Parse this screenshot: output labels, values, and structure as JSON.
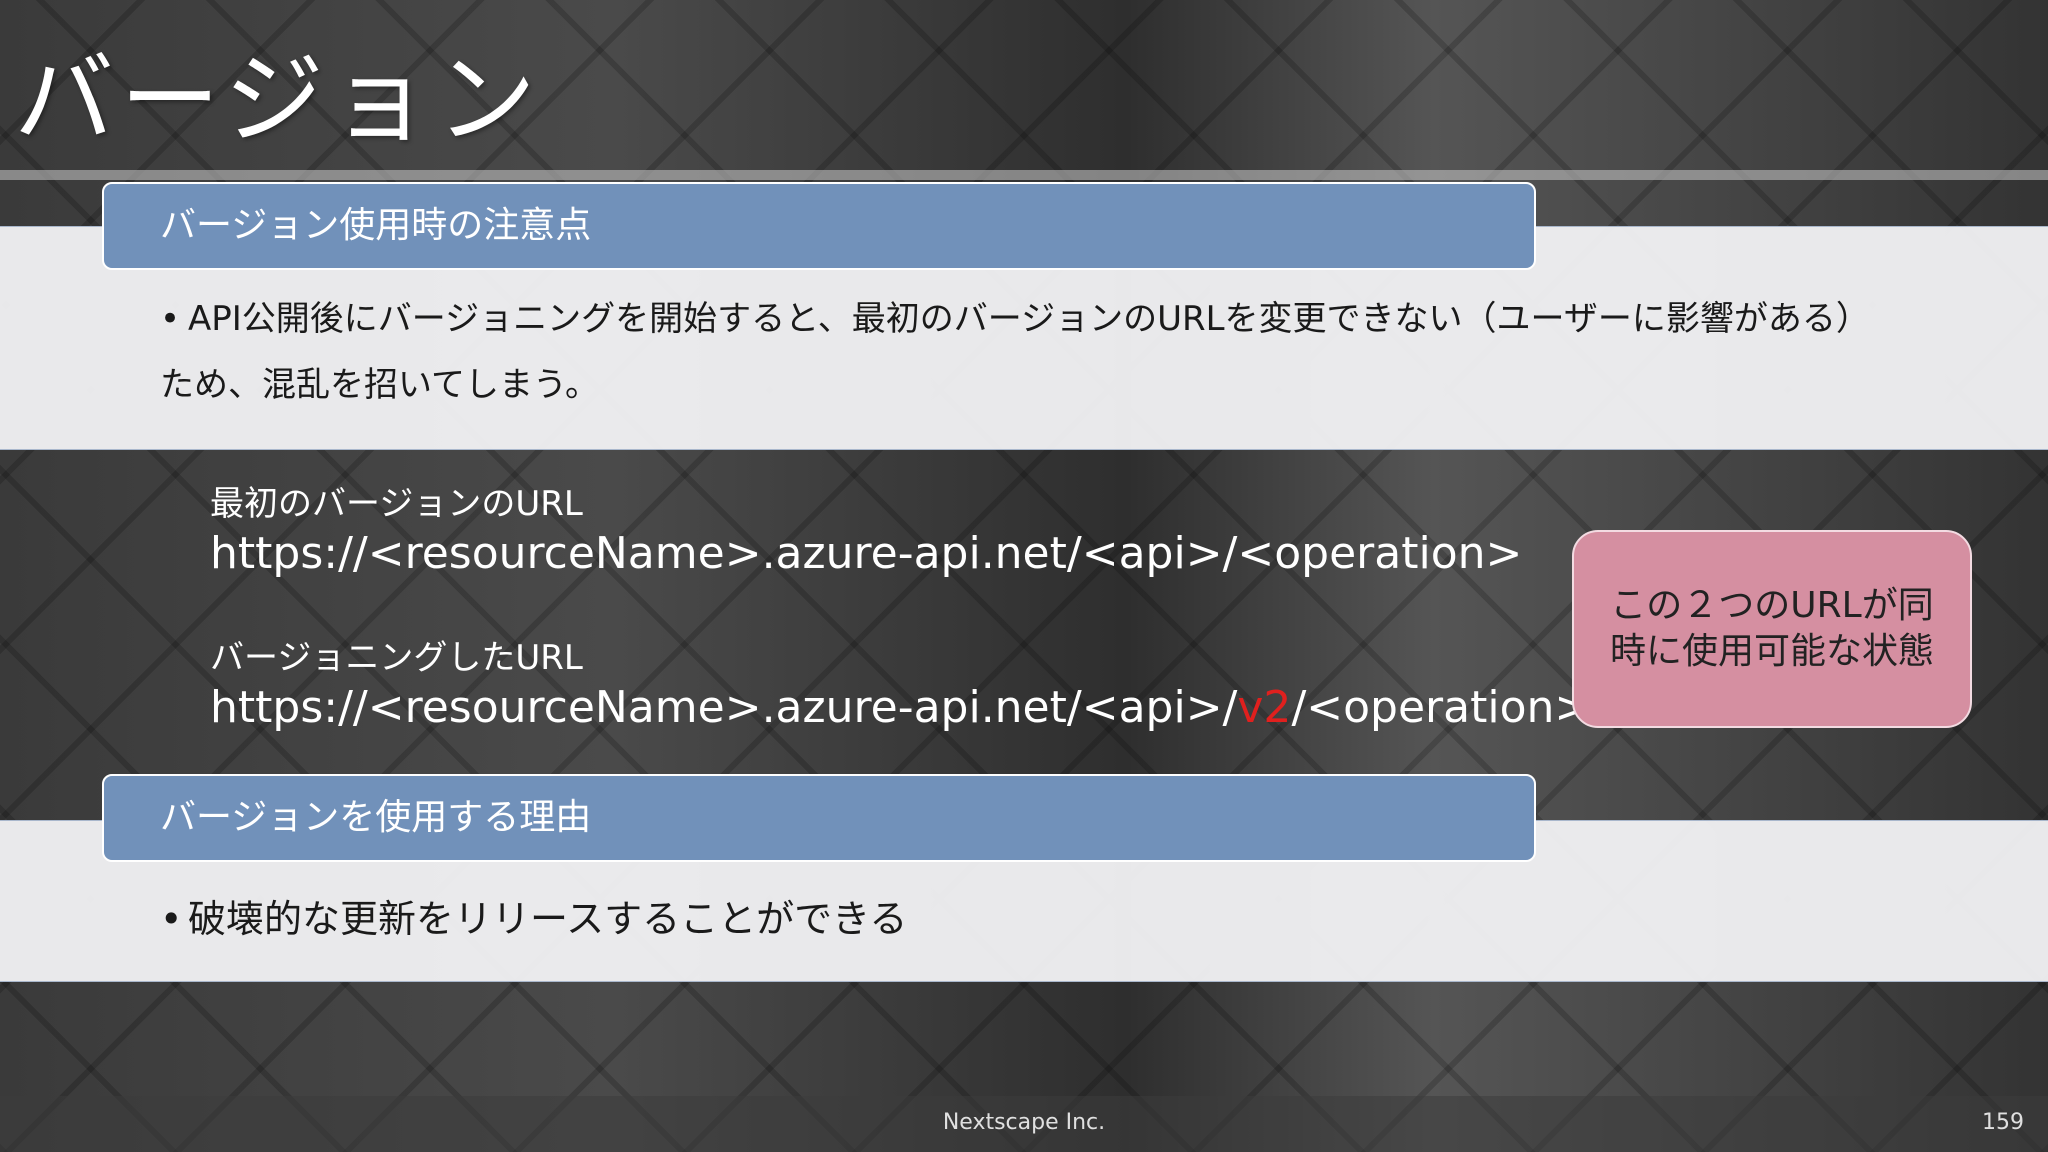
{
  "slide": {
    "title": "バージョン",
    "section1": {
      "header": "バージョン使用時の注意点",
      "bullet": "API公開後にバージョニングを開始すると、最初のバージョンのURLを変更できない（ユーザーに影響がある）ため、混乱を招いてしまう。"
    },
    "urls": {
      "first_label": "最初のバージョンのURL",
      "first_url": "https://<resourceName>.azure-api.net/<api>/<operation>",
      "versioned_label": "バージョニングしたURL",
      "versioned_url_prefix": "https://<resourceName>.azure-api.net/<api>/",
      "versioned_url_version": "v2",
      "versioned_url_suffix": "/<operation>"
    },
    "callout": "この２つのURLが同時に使用可能な状態",
    "section2": {
      "header": "バージョンを使用する理由",
      "bullet": "破壊的な更新をリリースすることができる"
    },
    "footer": {
      "company": "Nextscape Inc.",
      "page": "159"
    },
    "colors": {
      "header_bar": "#7191ba",
      "callout": "#d58fa1",
      "highlight": "#e0201e"
    }
  }
}
